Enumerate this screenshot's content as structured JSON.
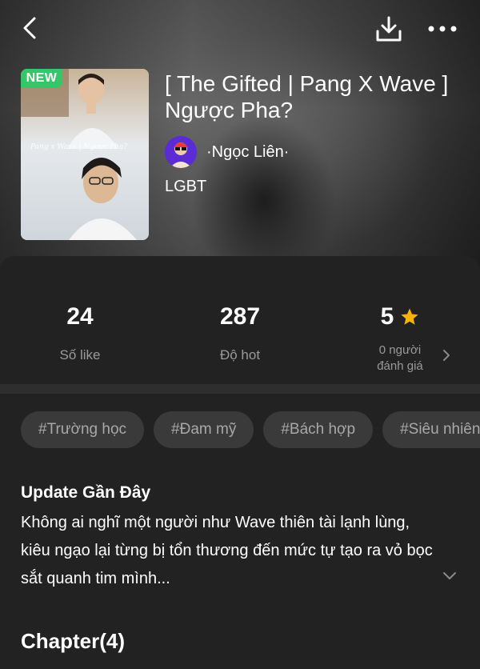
{
  "header": {
    "back_icon": "chevron-left-icon",
    "download_icon": "download-icon",
    "more_icon": "more-horizontal-icon"
  },
  "story": {
    "badge": "NEW",
    "cover_overlay": "Pang x Wave | Ngược Pha?",
    "title": "[ The Gifted | Pang X Wave ] Ngược Pha?",
    "author": "·Ngọc Liên·",
    "category": "LGBT"
  },
  "stats": {
    "likes": {
      "value": "24",
      "label": "Số like"
    },
    "hot": {
      "value": "287",
      "label": "Độ hot"
    },
    "rating": {
      "value": "5",
      "label_line1": "0 người",
      "label_line2": "đánh giá",
      "icon": "star-icon"
    }
  },
  "tags": [
    "#Trường học",
    "#Đam mỹ",
    "#Bách hợp",
    "#Siêu nhiên"
  ],
  "update": {
    "title": "Update Gần Đây",
    "text": "Không ai nghĩ một người như Wave thiên tài lạnh lùng, kiêu ngạo lại từng bị tổn thương đến mức tự tạo ra vỏ bọc sắt quanh tim mình..."
  },
  "chapters": {
    "label": "Chapter(4)"
  },
  "colors": {
    "background": "#222222",
    "badge": "#37c56a",
    "star": "#f5b400",
    "muted_text": "#9a9a9a",
    "tag_bg": "#3a3a3a"
  }
}
